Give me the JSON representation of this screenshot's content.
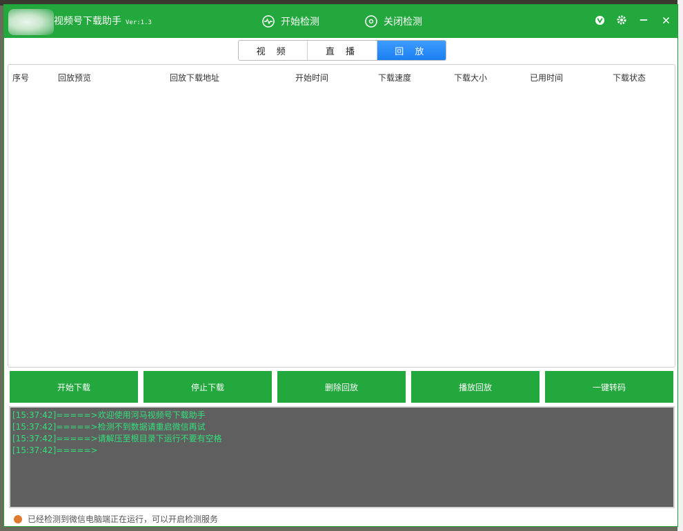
{
  "window": {
    "title": "视频号下载助手",
    "version": "Ver:1.3",
    "actions": {
      "start_detect": "开始检测",
      "stop_detect": "关闭检测"
    }
  },
  "tabs": [
    {
      "label": "视 频",
      "active": false
    },
    {
      "label": "直 播",
      "active": false
    },
    {
      "label": "回 放",
      "active": true
    }
  ],
  "table": {
    "columns": [
      "序号",
      "回放预览",
      "回放下载地址",
      "开始时间",
      "下载速度",
      "下载大小",
      "已用时间",
      "下载状态"
    ],
    "rows": []
  },
  "buttons": {
    "start_download": "开始下载",
    "stop_download": "停止下载",
    "delete_replay": "删除回放",
    "play_replay": "播放回放",
    "one_click_transcode": "一键转码"
  },
  "log": [
    "[15:37:42]=====>欢迎使用河马视频号下载助手",
    "[15:37:42]=====>检测不到数据请重启微信再试",
    "[15:37:42]=====>请解压至根目录下运行不要有空格",
    "[15:37:42]=====>"
  ],
  "status": {
    "text": "已经检测到微信电脑端正在运行，可以开启检测服务",
    "color": "#e07a2e"
  },
  "colors": {
    "accent": "#22a83c",
    "tab_active": "#1a7ff0",
    "log_bg": "#5f5f5f",
    "log_text": "#31e07a"
  }
}
